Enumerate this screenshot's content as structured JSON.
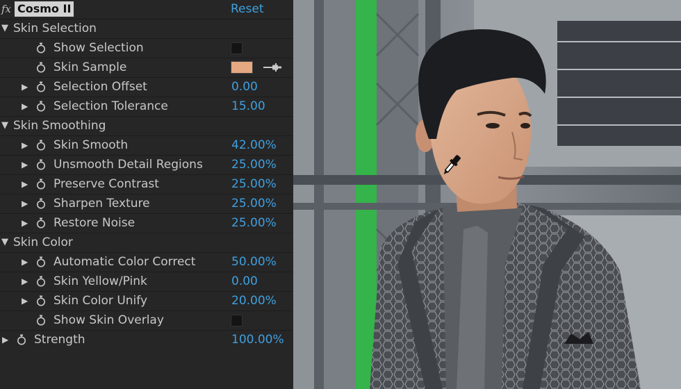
{
  "header": {
    "fx_label": "fx",
    "effect_name": "Cosmo II",
    "reset_label": "Reset"
  },
  "rows": {
    "skin_selection": {
      "label": "Skin Selection"
    },
    "show_selection": {
      "label": "Show Selection",
      "checked": false
    },
    "skin_sample": {
      "label": "Skin Sample",
      "color": "#e6a880"
    },
    "selection_offset": {
      "label": "Selection Offset",
      "value": "0.00"
    },
    "selection_tolerance": {
      "label": "Selection Tolerance",
      "value": "15.00"
    },
    "skin_smoothing": {
      "label": "Skin Smoothing"
    },
    "skin_smooth": {
      "label": "Skin Smooth",
      "value": "42.00%"
    },
    "unsmooth_detail": {
      "label": "Unsmooth Detail Regions",
      "value": "25.00%"
    },
    "preserve_contrast": {
      "label": "Preserve Contrast",
      "value": "25.00%"
    },
    "sharpen_texture": {
      "label": "Sharpen Texture",
      "value": "25.00%"
    },
    "restore_noise": {
      "label": "Restore Noise",
      "value": "25.00%"
    },
    "skin_color": {
      "label": "Skin Color"
    },
    "auto_color_correct": {
      "label": "Automatic Color Correct",
      "value": "50.00%"
    },
    "skin_yellow_pink": {
      "label": "Skin Yellow/Pink",
      "value": "0.00"
    },
    "skin_color_unify": {
      "label": "Skin Color Unify",
      "value": "20.00%"
    },
    "show_skin_overlay": {
      "label": "Show Skin Overlay",
      "checked": false
    },
    "strength": {
      "label": "Strength",
      "value": "100.00%"
    }
  },
  "colors": {
    "value_blue": "#3fa0e0",
    "panel_bg": "#262626",
    "sample_swatch": "#e6a880"
  },
  "icons": {
    "stopwatch": "stopwatch-icon",
    "eyedropper": "eyedropper-icon",
    "disclosure": "triangle-icon"
  }
}
